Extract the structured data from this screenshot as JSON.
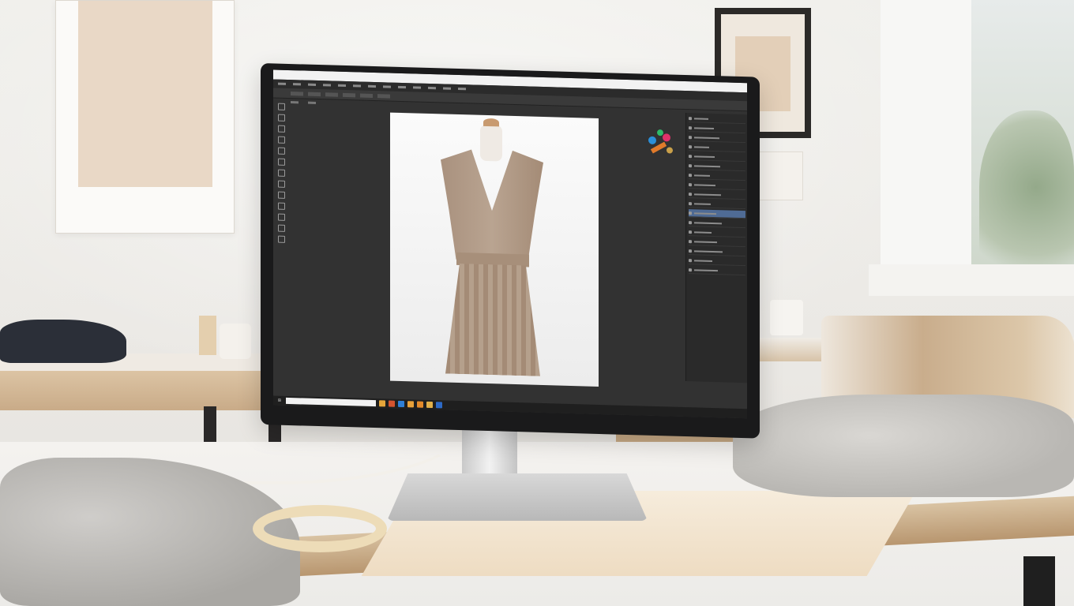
{
  "scene": {
    "description_free": true
  },
  "screen": {
    "app_title": "",
    "menu": [
      "",
      "",
      "",
      "",
      "",
      "",
      "",
      "",
      "",
      "",
      "",
      "",
      ""
    ],
    "tabs": [
      "",
      ""
    ],
    "options": [
      "",
      "",
      "",
      "",
      "",
      ""
    ],
    "layers_panel": [
      "",
      "",
      "",
      "",
      "",
      "",
      "",
      "",
      "",
      "",
      "",
      "",
      "",
      "",
      "",
      "",
      ""
    ],
    "taskbar": {
      "search_placeholder": "",
      "tray_text": ""
    },
    "colors": {
      "selected_layer": "#4f6b95",
      "panel_bg": "#2a2a2a",
      "workspace_bg": "#323232"
    },
    "taskbar_icon_colors": [
      "#e5a53a",
      "#d4542f",
      "#2f7fd6",
      "#e8a13a",
      "#e38a2b",
      "#e2b04a",
      "#2d6ac7"
    ]
  }
}
